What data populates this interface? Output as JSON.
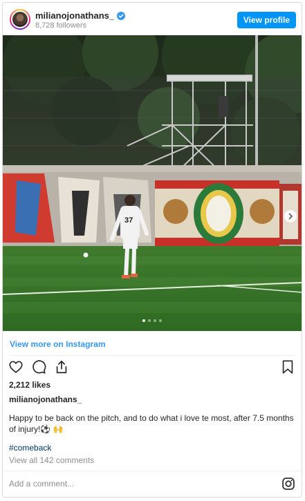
{
  "header": {
    "username": "milianojonathans_",
    "verified_icon": "verified-badge-icon",
    "followers": "8,728 followers",
    "view_profile_label": "View profile"
  },
  "carousel": {
    "slide_count": 4,
    "active_slide": 1
  },
  "links": {
    "view_more": "View more on Instagram"
  },
  "actions": {
    "icons": [
      "heart-icon",
      "comment-icon",
      "share-icon",
      "bookmark-icon"
    ]
  },
  "post": {
    "likes": "2,212 likes",
    "caption_user": "milianojonathans_",
    "caption": "Happy to be back on the pitch, and to do what i love te most, after 7.5 months of injury!⚽ 🙌",
    "hashtag": "#comeback",
    "comments": "View all 142 comments"
  },
  "comment_box": {
    "placeholder": "Add a comment..."
  },
  "colors": {
    "accent": "#0095f6",
    "link": "#3897f0",
    "muted": "#8e8e8e",
    "hashtag": "#00376b"
  }
}
